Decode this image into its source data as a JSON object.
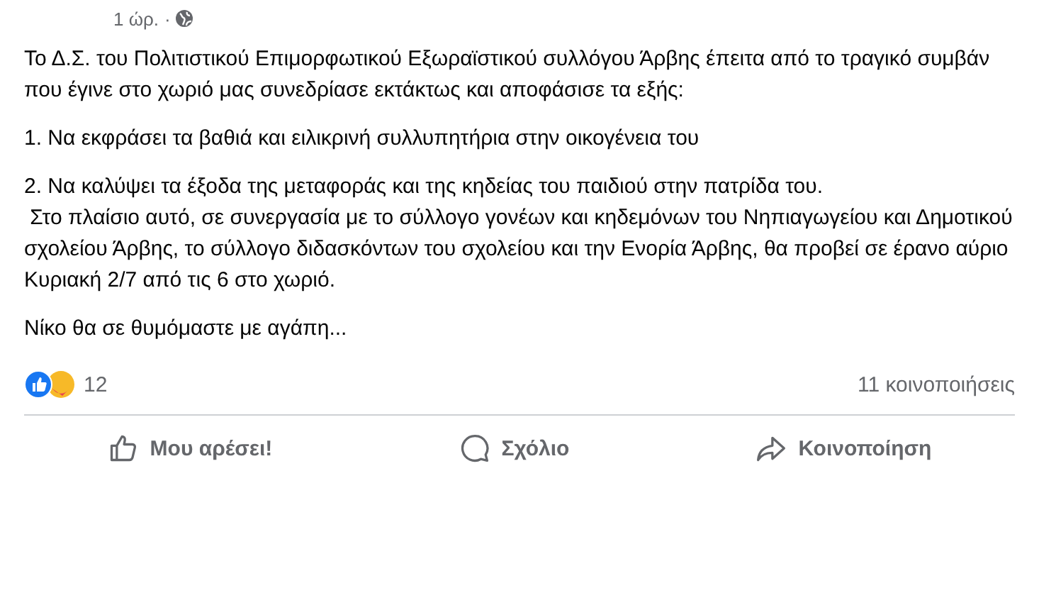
{
  "post": {
    "time": "1 ώρ.",
    "separator": "·",
    "paragraphs": [
      "Το Δ.Σ. του Πολιτιστικού Επιμορφωτικού Εξωραϊστικού συλλόγου Άρβης έπειτα από το τραγικό συμβάν που έγινε στο χωριό μας συνεδρίασε εκτάκτως και αποφάσισε τα εξής:",
      "1. Να εκφράσει τα βαθιά και ειλικρινή συλλυπητήρια στην οικογένεια του",
      "2. Να καλύψει τα έξοδα της μεταφοράς και της κηδείας του παιδιού στην πατρίδα του.\n Στο πλαίσιο αυτό, σε συνεργασία με το σύλλογο γονέων και κηδεμόνων του Νηπιαγωγείου και Δημοτικού σχολείου Άρβης, το σύλλογο διδασκόντων του σχολείου και την Ενορία Άρβης, θα προβεί σε έρανο αύριο Κυριακή 2/7 από τις 6 στο χωριό.",
      "Νίκο θα σε θυμόμαστε με αγάπη..."
    ]
  },
  "reactions": {
    "count": "12",
    "shares": "11 κοινοποιήσεις"
  },
  "actions": [
    {
      "kind": "like",
      "label": "Μου αρέσει!"
    },
    {
      "kind": "comment",
      "label": "Σχόλιο"
    },
    {
      "kind": "share",
      "label": "Κοινοποίηση"
    }
  ]
}
